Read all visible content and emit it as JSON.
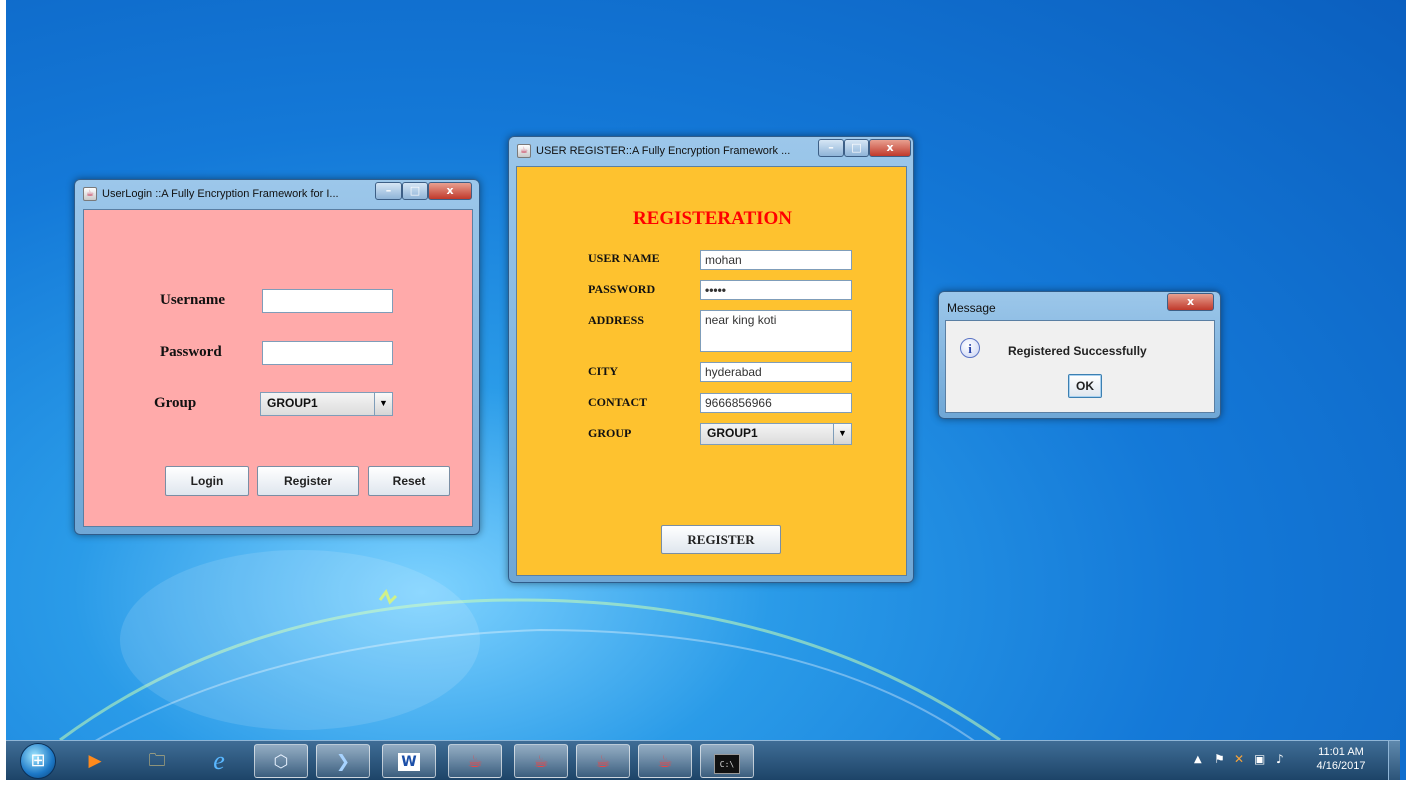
{
  "login_window": {
    "title": "UserLogin ::A Fully Encryption Framework for I...",
    "username_label": "Username",
    "username_value": "",
    "password_label": "Password",
    "password_value": "",
    "group_label": "Group",
    "group_selected": "GROUP1",
    "login_button": "Login",
    "register_button": "Register",
    "reset_button": "Reset",
    "background_color": "#ffaaaa"
  },
  "register_window": {
    "title": "USER REGISTER::A Fully Encryption Framework ...",
    "heading": "REGISTERATION",
    "username_label": "USER NAME",
    "username_value": "mohan",
    "password_label": "PASSWORD",
    "password_value": "•••••",
    "address_label": "ADDRESS",
    "address_value": "near king koti",
    "city_label": "CITY",
    "city_value": "hyderabad",
    "contact_label": "CONTACT",
    "contact_value": "9666856966",
    "group_label": "GROUP",
    "group_selected": "GROUP1",
    "register_button": "REGISTER",
    "background_color": "#fec22f",
    "heading_color": "#ff0000"
  },
  "message_dialog": {
    "title": "Message",
    "message": "Registered Successfully",
    "ok_button": "OK",
    "icon": "info-icon"
  },
  "window_controls": {
    "minimize": "–",
    "maximize": "□",
    "close": "x"
  },
  "taskbar": {
    "apps": [
      {
        "icon": "start-orb-icon",
        "glyph": "⊞"
      },
      {
        "icon": "media-player-icon",
        "glyph": "▶"
      },
      {
        "icon": "file-explorer-icon",
        "glyph": "🗀"
      },
      {
        "icon": "internet-explorer-icon",
        "glyph": "e"
      },
      {
        "icon": "virtualbox-icon",
        "glyph": "⬡"
      },
      {
        "icon": "netbeans-icon",
        "glyph": "❯"
      },
      {
        "icon": "word-icon",
        "glyph": "W"
      },
      {
        "icon": "java-icon",
        "glyph": "☕"
      },
      {
        "icon": "java-icon",
        "glyph": "☕"
      },
      {
        "icon": "java-icon",
        "glyph": "☕"
      },
      {
        "icon": "java-icon",
        "glyph": "☕"
      },
      {
        "icon": "command-prompt-icon",
        "glyph": "C:\\"
      }
    ],
    "time": "11:01 AM",
    "date": "4/16/2017"
  }
}
